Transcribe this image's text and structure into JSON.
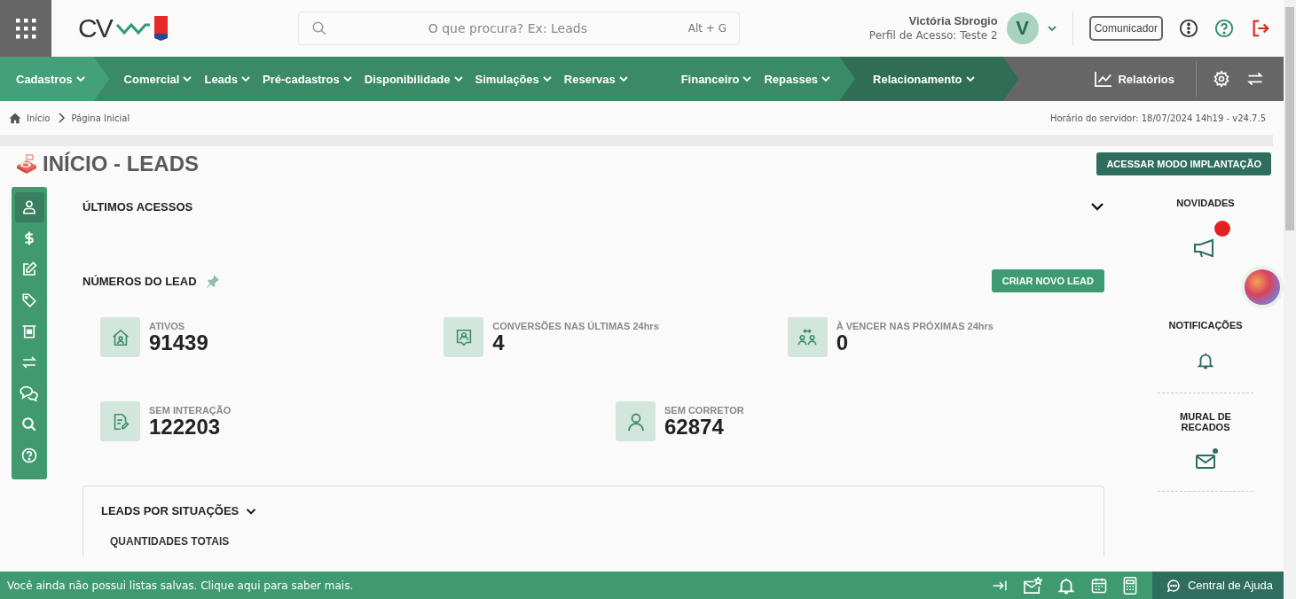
{
  "topbar": {
    "logo": "CV",
    "search": {
      "placeholder": "O que procura? Ex: Leads",
      "shortcut": "Alt + G"
    },
    "user": {
      "name": "Victória Sbrogio",
      "profile": "Perfil de Acesso: Teste 2",
      "initial": "V"
    },
    "communicator": "Comunicador"
  },
  "nav": {
    "groups": [
      {
        "items": [
          "Cadastros"
        ]
      },
      {
        "items": [
          "Comercial",
          "Leads",
          "Pré-cadastros",
          "Disponibilidade",
          "Simulações",
          "Reservas"
        ]
      },
      {
        "items": [
          "Financeiro",
          "Repasses"
        ]
      },
      {
        "items": [
          "Relacionamento"
        ]
      }
    ],
    "reports": "Relatórios"
  },
  "breadcrumb": [
    "Início",
    "Página Inicial"
  ],
  "server_time": "Horário do servidor: 18/07/2024 14h19 - v24.7.5",
  "page_title": "INÍCIO - LEADS",
  "implant_button": "ACESSAR MODO IMPLANTAÇÃO",
  "rail": [
    {
      "kind": "user",
      "selected": true
    },
    {
      "kind": "dollar",
      "selected": false
    },
    {
      "kind": "edit",
      "selected": false
    },
    {
      "kind": "tag",
      "selected": false
    },
    {
      "kind": "atm",
      "selected": false
    },
    {
      "kind": "transfer",
      "selected": false
    },
    {
      "kind": "chat",
      "selected": false
    },
    {
      "kind": "search",
      "selected": false
    },
    {
      "kind": "help",
      "selected": false
    }
  ],
  "recent": {
    "title": "ÚLTIMOS ACESSOS"
  },
  "numbers": {
    "title": "NÚMEROS DO LEAD",
    "create_button": "CRIAR NOVO LEAD",
    "rows": [
      [
        {
          "kind": "home",
          "label": "ATIVOS",
          "value": "91439"
        },
        {
          "kind": "badge",
          "label": "CONVERSÕES NAS ÚLTIMAS 24hrs",
          "value": "4"
        },
        {
          "kind": "people",
          "label": "À VENCER NAS PRÓXIMAS 24hrs",
          "value": "0"
        }
      ],
      [
        {
          "kind": "doc",
          "label": "SEM INTERAÇÃO",
          "value": "122203"
        },
        {
          "kind": "person",
          "label": "SEM CORRETOR",
          "value": "62874"
        }
      ]
    ]
  },
  "situations": {
    "title": "LEADS POR SITUAÇÕES",
    "subtitle": "QUANTIDADES TOTAIS"
  },
  "side_panel": [
    {
      "kind": "news",
      "label": "NOVIDADES",
      "unread": true
    },
    {
      "kind": "bell",
      "label": "NOTIFICAÇÕES",
      "unread": false
    },
    {
      "kind": "mail",
      "label": "MURAL DE RECADOS",
      "unread": true
    }
  ],
  "status_bar": {
    "message": "Você ainda não possui listas salvas. Clique aqui para saber mais.",
    "tools": [
      {
        "kind": "collapse"
      },
      {
        "kind": "mail-star"
      },
      {
        "kind": "bell"
      },
      {
        "kind": "calendar"
      },
      {
        "kind": "calculator"
      }
    ],
    "help": "Central de Ajuda"
  }
}
